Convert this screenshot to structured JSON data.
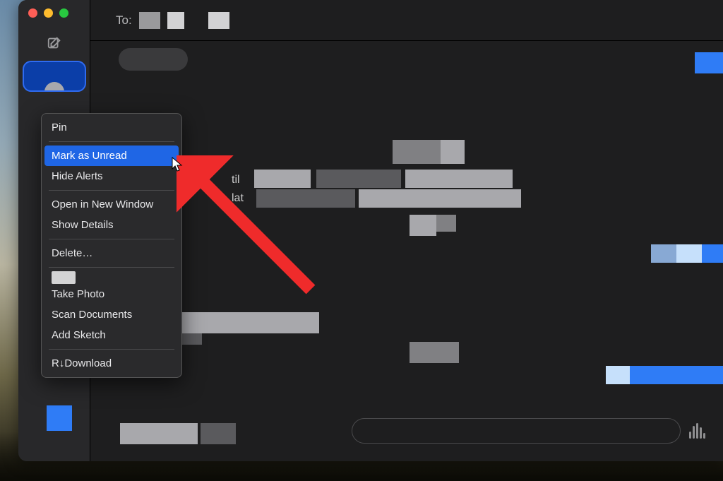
{
  "header": {
    "to_label": "To:"
  },
  "context_menu": {
    "pin": "Pin",
    "mark_unread": "Mark as Unread",
    "hide_alerts": "Hide Alerts",
    "open_new_window": "Open in New Window",
    "show_details": "Show Details",
    "delete": "Delete…",
    "take_photo": "Take Photo",
    "scan_documents": "Scan Documents",
    "add_sketch": "Add Sketch",
    "download": "R↓Download"
  },
  "visible_text_fragments": {
    "f1": "til",
    "f2": "lat"
  }
}
